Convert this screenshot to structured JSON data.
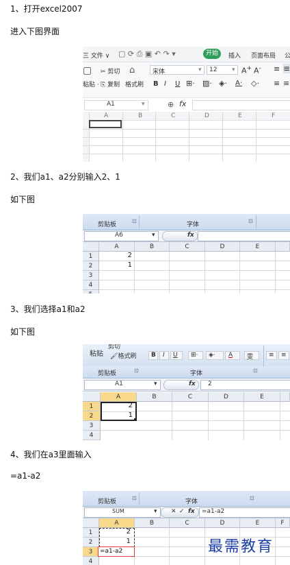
{
  "steps": {
    "s1": "1、打开excel2007",
    "s1_sub": "进入下图界面",
    "s2": "2、我们a1、a2分别输入2、1",
    "s2_sub": "如下图",
    "s3": "3、我们选择a1和a2",
    "s3_sub": "如下图",
    "s4": "4、我们在a3里面输入",
    "s4_sub": "=a1-a2"
  },
  "shot1": {
    "menu": {
      "file": "三 文件 ∨",
      "start": "开始",
      "insert": "插入",
      "layout": "页面布局",
      "formula": "公"
    },
    "clip": {
      "cut": "✂ 剪切",
      "paste": "粘贴 ·",
      "copy": "复制",
      "format": "格式刷"
    },
    "font": {
      "name": "宋体",
      "size": "12"
    },
    "namebox": "A1",
    "fx": "fx",
    "cols": [
      "A",
      "B",
      "C",
      "D",
      "E",
      "F"
    ],
    "rows": [
      "1",
      "2",
      "3",
      "4",
      "5"
    ]
  },
  "shot2": {
    "ribbon": {
      "clipboard": "剪贴板",
      "font": "字体"
    },
    "namebox": "A6",
    "fx": "fx",
    "cols": [
      "A",
      "B",
      "C",
      "D",
      "E"
    ],
    "rows": [
      "1",
      "2",
      "3",
      "4",
      "5"
    ],
    "a1": "2",
    "a2": "1"
  },
  "shot3": {
    "ribbon": {
      "paste": "粘贴",
      "cut": "剪切",
      "format": "格式刷",
      "clipboard": "剪贴板",
      "font": "字体",
      "bold": "B",
      "italic": "I",
      "underline": "U",
      "color_a": "A",
      "wen": "雯"
    },
    "namebox": "A1",
    "fx": "fx",
    "formula_value": "2",
    "cols": [
      "A",
      "B",
      "C",
      "D",
      "E"
    ],
    "rows": [
      "1",
      "2",
      "3",
      "4"
    ],
    "a1": "2",
    "a2": "1"
  },
  "shot4": {
    "ribbon": {
      "clipboard": "剪贴板",
      "font": "字体"
    },
    "namebox": "SUM",
    "fx": "fx",
    "formula_value": "=a1-a2",
    "cols": [
      "A",
      "B",
      "C",
      "D",
      "E",
      "F"
    ],
    "rows": [
      "1",
      "2",
      "3",
      "4"
    ],
    "a1": "2",
    "a2": "1",
    "a3": "=a1-a2",
    "watermark": "最需教育"
  }
}
